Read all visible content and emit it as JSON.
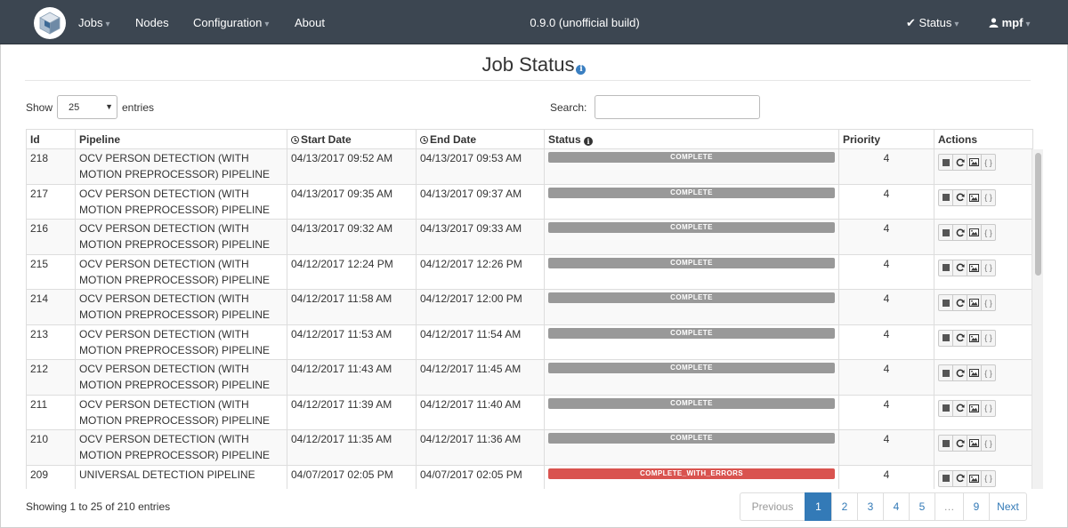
{
  "navbar": {
    "menu": [
      {
        "label": "Jobs",
        "dropdown": true
      },
      {
        "label": "Nodes",
        "dropdown": false
      },
      {
        "label": "Configuration",
        "dropdown": true
      },
      {
        "label": "About",
        "dropdown": false
      }
    ],
    "build": "0.9.0 (unofficial build)",
    "status_label": "Status",
    "user_label": "mpf"
  },
  "page": {
    "title": "Job Status",
    "info_icon": "info-circle-icon"
  },
  "controls": {
    "show_label": "Show",
    "length_value": "25",
    "entries_label": "entries",
    "search_label": "Search:",
    "search_value": ""
  },
  "table": {
    "columns": [
      "Id",
      "Pipeline",
      "Start Date",
      "End Date",
      "Status",
      "Priority",
      "Actions"
    ],
    "rows": [
      {
        "id": "218",
        "pipeline": "OCV PERSON DETECTION (WITH MOTION PREPROCESSOR) PIPELINE",
        "start": "04/13/2017 09:52 AM",
        "end": "04/13/2017 09:53 AM",
        "status": "COMPLETE",
        "priority": "4"
      },
      {
        "id": "217",
        "pipeline": "OCV PERSON DETECTION (WITH MOTION PREPROCESSOR) PIPELINE",
        "start": "04/13/2017 09:35 AM",
        "end": "04/13/2017 09:37 AM",
        "status": "COMPLETE",
        "priority": "4"
      },
      {
        "id": "216",
        "pipeline": "OCV PERSON DETECTION (WITH MOTION PREPROCESSOR) PIPELINE",
        "start": "04/13/2017 09:32 AM",
        "end": "04/13/2017 09:33 AM",
        "status": "COMPLETE",
        "priority": "4"
      },
      {
        "id": "215",
        "pipeline": "OCV PERSON DETECTION (WITH MOTION PREPROCESSOR) PIPELINE",
        "start": "04/12/2017 12:24 PM",
        "end": "04/12/2017 12:26 PM",
        "status": "COMPLETE",
        "priority": "4"
      },
      {
        "id": "214",
        "pipeline": "OCV PERSON DETECTION (WITH MOTION PREPROCESSOR) PIPELINE",
        "start": "04/12/2017 11:58 AM",
        "end": "04/12/2017 12:00 PM",
        "status": "COMPLETE",
        "priority": "4"
      },
      {
        "id": "213",
        "pipeline": "OCV PERSON DETECTION (WITH MOTION PREPROCESSOR) PIPELINE",
        "start": "04/12/2017 11:53 AM",
        "end": "04/12/2017 11:54 AM",
        "status": "COMPLETE",
        "priority": "4"
      },
      {
        "id": "212",
        "pipeline": "OCV PERSON DETECTION (WITH MOTION PREPROCESSOR) PIPELINE",
        "start": "04/12/2017 11:43 AM",
        "end": "04/12/2017 11:45 AM",
        "status": "COMPLETE",
        "priority": "4"
      },
      {
        "id": "211",
        "pipeline": "OCV PERSON DETECTION (WITH MOTION PREPROCESSOR) PIPELINE",
        "start": "04/12/2017 11:39 AM",
        "end": "04/12/2017 11:40 AM",
        "status": "COMPLETE",
        "priority": "4"
      },
      {
        "id": "210",
        "pipeline": "OCV PERSON DETECTION (WITH MOTION PREPROCESSOR) PIPELINE",
        "start": "04/12/2017 11:35 AM",
        "end": "04/12/2017 11:36 AM",
        "status": "COMPLETE",
        "priority": "4"
      },
      {
        "id": "209",
        "pipeline": "UNIVERSAL DETECTION PIPELINE",
        "start": "04/07/2017 02:05 PM",
        "end": "04/07/2017 02:05 PM",
        "status": "COMPLETE_WITH_ERRORS",
        "priority": "4"
      }
    ],
    "action_icons": [
      "stop-icon",
      "resubmit-icon",
      "media-icon",
      "json-output-icon"
    ],
    "json_icon_text": "{ }"
  },
  "colors": {
    "navbar_bg": "#3c4651",
    "status_complete": "#999999",
    "status_complete_with_errors": "#d9534f",
    "pager_active": "#337ab7"
  },
  "footer": {
    "info": "Showing 1 to 25 of 210 entries",
    "pagination": [
      "Previous",
      "1",
      "2",
      "3",
      "4",
      "5",
      "…",
      "9",
      "Next"
    ],
    "active_page": "1"
  }
}
